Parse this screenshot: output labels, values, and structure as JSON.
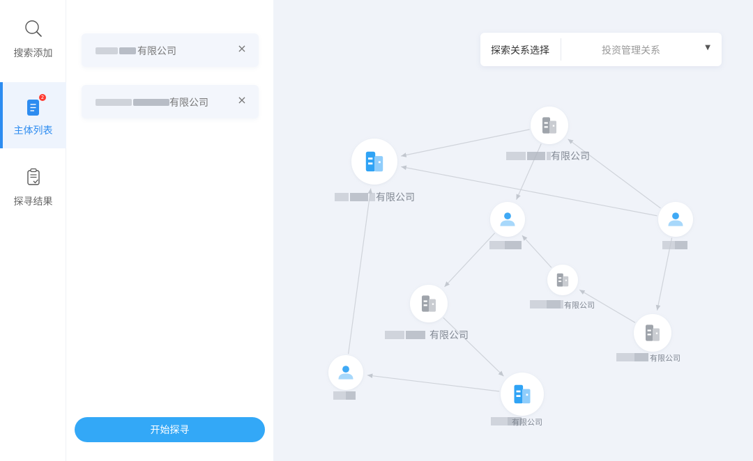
{
  "nav": {
    "items": [
      {
        "label": "搜索添加",
        "icon": "search-icon",
        "active": false
      },
      {
        "label": "主体列表",
        "icon": "list-doc-icon",
        "active": true,
        "badge": "2"
      },
      {
        "label": "探寻结果",
        "icon": "clipboard-check-icon",
        "active": false
      }
    ]
  },
  "panel": {
    "chips": [
      {
        "suffix": "有限公司",
        "close": "×"
      },
      {
        "suffix": "有限公司",
        "close": "×"
      }
    ],
    "start_label": "开始探寻"
  },
  "selector": {
    "label": "探索关系选择",
    "value": "投资管理关系",
    "caret": "▼"
  },
  "graph": {
    "nodes": [
      {
        "id": "n0",
        "type": "company",
        "highlight": true,
        "label": "有限公司"
      },
      {
        "id": "n1",
        "type": "company",
        "highlight": false,
        "label": "有限公司"
      },
      {
        "id": "n2",
        "type": "person",
        "highlight": true,
        "label": ""
      },
      {
        "id": "n3",
        "type": "person",
        "highlight": true,
        "label": ""
      },
      {
        "id": "n4",
        "type": "company",
        "highlight": false,
        "label": "有限公司"
      },
      {
        "id": "n5",
        "type": "company",
        "highlight": false,
        "label": "有限公司"
      },
      {
        "id": "n6",
        "type": "company",
        "highlight": false,
        "label": "有限公司"
      },
      {
        "id": "n7",
        "type": "person",
        "highlight": true,
        "label": ""
      },
      {
        "id": "n8",
        "type": "company",
        "highlight": true,
        "label": "有限公司"
      }
    ],
    "edges": [
      {
        "from": "n1",
        "to": "n0"
      },
      {
        "from": "n3",
        "to": "n0"
      },
      {
        "from": "n3",
        "to": "n1"
      },
      {
        "from": "n1",
        "to": "n2"
      },
      {
        "from": "n2",
        "to": "n5"
      },
      {
        "from": "n4",
        "to": "n2"
      },
      {
        "from": "n6",
        "to": "n4"
      },
      {
        "from": "n3",
        "to": "n6"
      },
      {
        "from": "n7",
        "to": "n0"
      },
      {
        "from": "n8",
        "to": "n7"
      },
      {
        "from": "n5",
        "to": "n8"
      }
    ]
  },
  "colors": {
    "accent": "#2d8cf0",
    "button": "#33a8f7",
    "company_blue": "#2fa3f5",
    "company_blue_light": "#8fcdfb",
    "company_gray": "#9fa4ab",
    "company_gray_light": "#c9ccd1",
    "person_blue": "#3fa9f5",
    "person_blue_light": "#a7d8fb",
    "edge": "#cfd3da",
    "blur": "#c6cad1",
    "blur_dark": "#aeb3bc"
  }
}
